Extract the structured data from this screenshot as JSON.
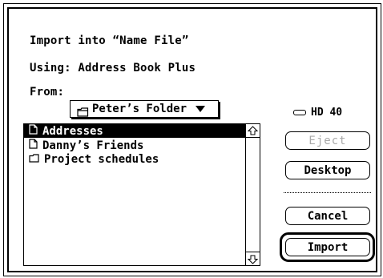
{
  "dialog": {
    "import_into": "Import into “Name File”",
    "using": "Using: Address Book Plus",
    "from_label": "From:"
  },
  "folder_popup": {
    "label": "Peter’s Folder",
    "icon": "folder-icon"
  },
  "drive": {
    "label": "HD 40",
    "icon": "hard-drive-icon"
  },
  "file_list": {
    "items": [
      {
        "label": "Addresses",
        "icon": "document-icon",
        "selected": true
      },
      {
        "label": "Danny’s Friends",
        "icon": "document-icon",
        "selected": false
      },
      {
        "label": "Project schedules",
        "icon": "folder-icon",
        "selected": false
      }
    ]
  },
  "buttons": {
    "eject": "Eject",
    "desktop": "Desktop",
    "cancel": "Cancel",
    "import": "Import"
  }
}
